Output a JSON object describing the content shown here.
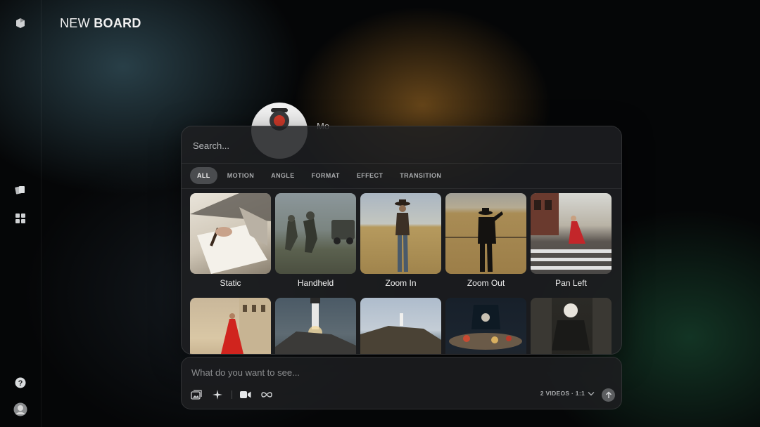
{
  "board": {
    "title_prefix": "NEW",
    "title_bold": "BOARD"
  },
  "agent": {
    "name": "Mo"
  },
  "panel": {
    "search_placeholder": "Search...",
    "tabs": [
      {
        "label": "ALL",
        "active": true
      },
      {
        "label": "MOTION",
        "active": false
      },
      {
        "label": "ANGLE",
        "active": false
      },
      {
        "label": "FORMAT",
        "active": false
      },
      {
        "label": "EFFECT",
        "active": false
      },
      {
        "label": "TRANSITION",
        "active": false
      }
    ],
    "presets": [
      {
        "label": "Static"
      },
      {
        "label": "Handheld"
      },
      {
        "label": "Zoom In"
      },
      {
        "label": "Zoom Out"
      },
      {
        "label": "Pan Left"
      },
      {
        "label": ""
      },
      {
        "label": ""
      },
      {
        "label": ""
      },
      {
        "label": ""
      },
      {
        "label": ""
      }
    ]
  },
  "prompt": {
    "placeholder": "What do you want to see...",
    "settings_label": "2 VIDEOS · 1:1"
  },
  "icons": {
    "logo": "logo-icon",
    "library": "library-icon",
    "boards": "grid-icon",
    "help": "help-icon",
    "user": "user-avatar",
    "image_ref": "image-icon",
    "enhance": "sparkle-icon",
    "video": "video-camera-icon",
    "loop": "infinity-icon",
    "chevron": "chevron-down-icon",
    "send": "arrow-up-icon"
  },
  "colors": {
    "panel_bg": "#1e2022",
    "tab_active_bg": "#4a4c4f",
    "accent_orange": "#b4782a",
    "accent_green": "#1e5a3c",
    "accent_teal": "#466e7d"
  }
}
